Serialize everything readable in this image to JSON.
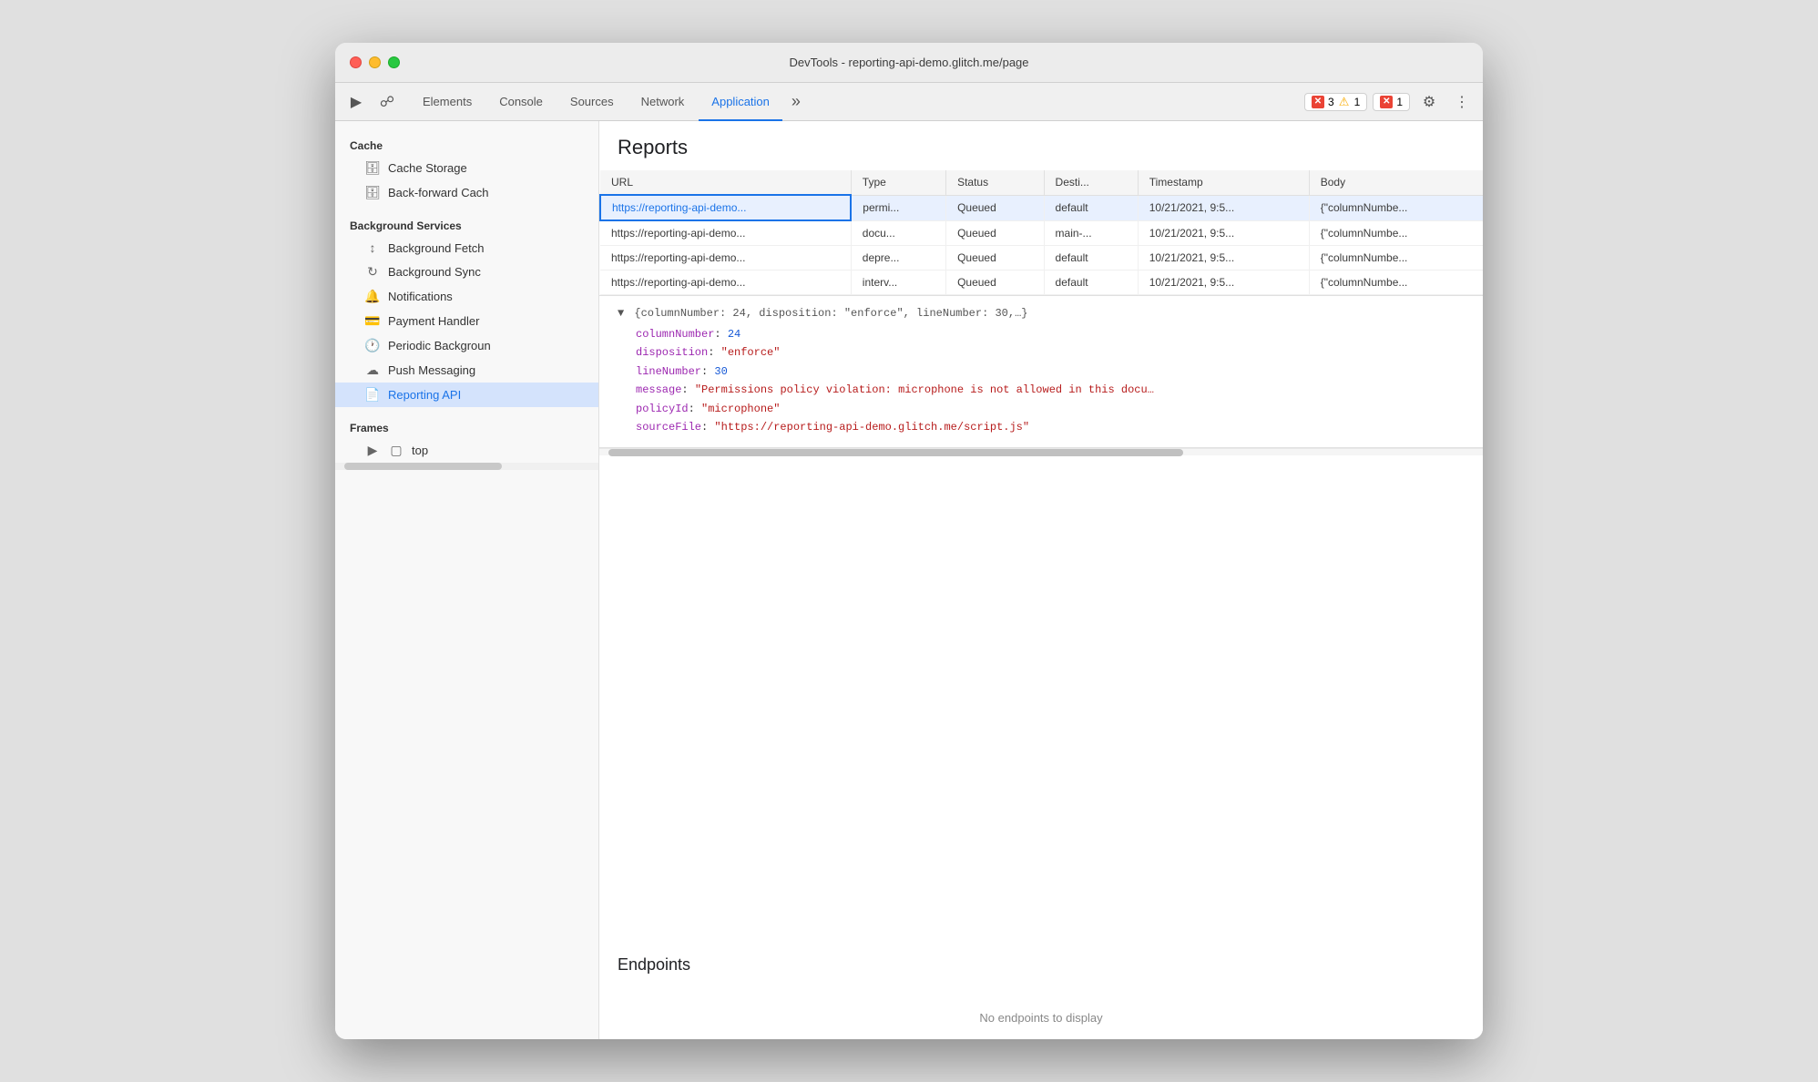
{
  "window": {
    "title": "DevTools - reporting-api-demo.glitch.me/page"
  },
  "toolbar": {
    "tabs": [
      {
        "id": "elements",
        "label": "Elements",
        "active": false
      },
      {
        "id": "console",
        "label": "Console",
        "active": false
      },
      {
        "id": "sources",
        "label": "Sources",
        "active": false
      },
      {
        "id": "network",
        "label": "Network",
        "active": false
      },
      {
        "id": "application",
        "label": "Application",
        "active": true
      }
    ],
    "error_count": "3",
    "warning_count": "1",
    "error2_count": "1"
  },
  "sidebar": {
    "cache_header": "Cache",
    "cache_storage_label": "Cache Storage",
    "back_forward_label": "Back-forward Cach",
    "background_services_header": "Background Services",
    "background_fetch_label": "Background Fetch",
    "background_sync_label": "Background Sync",
    "notifications_label": "Notifications",
    "payment_handler_label": "Payment Handler",
    "periodic_background_label": "Periodic Backgroun",
    "push_messaging_label": "Push Messaging",
    "reporting_api_label": "Reporting API",
    "frames_header": "Frames",
    "top_label": "top"
  },
  "reports": {
    "title": "Reports",
    "columns": {
      "url": "URL",
      "type": "Type",
      "status": "Status",
      "destination": "Desti...",
      "timestamp": "Timestamp",
      "body": "Body"
    },
    "rows": [
      {
        "url": "https://reporting-api-demo...",
        "type": "permi...",
        "status": "Queued",
        "destination": "default",
        "timestamp": "10/21/2021, 9:5...",
        "body": "{\"columnNumbe...",
        "selected": true
      },
      {
        "url": "https://reporting-api-demo...",
        "type": "docu...",
        "status": "Queued",
        "destination": "main-...",
        "timestamp": "10/21/2021, 9:5...",
        "body": "{\"columnNumbe...",
        "selected": false
      },
      {
        "url": "https://reporting-api-demo...",
        "type": "depre...",
        "status": "Queued",
        "destination": "default",
        "timestamp": "10/21/2021, 9:5...",
        "body": "{\"columnNumbe...",
        "selected": false
      },
      {
        "url": "https://reporting-api-demo...",
        "type": "interv...",
        "status": "Queued",
        "destination": "default",
        "timestamp": "10/21/2021, 9:5...",
        "body": "{\"columnNumbe...",
        "selected": false
      }
    ],
    "detail": {
      "header": "{columnNumber: 24, disposition: \"enforce\", lineNumber: 30,…}",
      "lines": [
        {
          "key": "columnNumber",
          "colon": ":",
          "value": "24",
          "type": "number"
        },
        {
          "key": "disposition",
          "colon": ":",
          "value": "\"enforce\"",
          "type": "string"
        },
        {
          "key": "lineNumber",
          "colon": ":",
          "value": "30",
          "type": "number"
        },
        {
          "key": "message",
          "colon": ":",
          "value": "\"Permissions policy violation: microphone is not allowed in this docu…",
          "type": "string"
        },
        {
          "key": "policyId",
          "colon": ":",
          "value": "\"microphone\"",
          "type": "string"
        },
        {
          "key": "sourceFile",
          "colon": ":",
          "value": "\"https://reporting-api-demo.glitch.me/script.js\"",
          "type": "string"
        }
      ]
    }
  },
  "endpoints": {
    "title": "Endpoints",
    "empty_text": "No endpoints to display"
  }
}
